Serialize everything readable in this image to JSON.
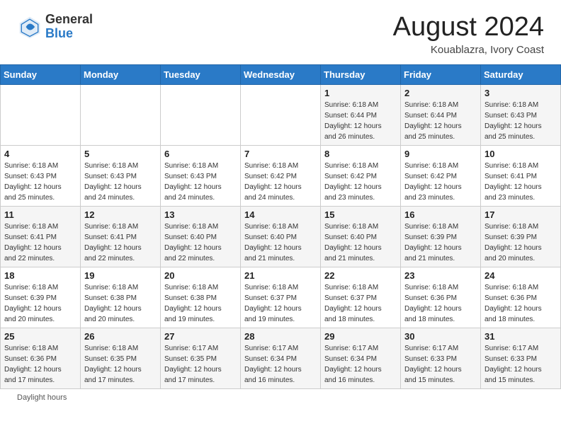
{
  "logo": {
    "general": "General",
    "blue": "Blue"
  },
  "title": {
    "main": "August 2024",
    "sub": "Kouablazra, Ivory Coast"
  },
  "calendar": {
    "headers": [
      "Sunday",
      "Monday",
      "Tuesday",
      "Wednesday",
      "Thursday",
      "Friday",
      "Saturday"
    ],
    "weeks": [
      [
        {
          "day": "",
          "info": ""
        },
        {
          "day": "",
          "info": ""
        },
        {
          "day": "",
          "info": ""
        },
        {
          "day": "",
          "info": ""
        },
        {
          "day": "1",
          "info": "Sunrise: 6:18 AM\nSunset: 6:44 PM\nDaylight: 12 hours\nand 26 minutes."
        },
        {
          "day": "2",
          "info": "Sunrise: 6:18 AM\nSunset: 6:44 PM\nDaylight: 12 hours\nand 25 minutes."
        },
        {
          "day": "3",
          "info": "Sunrise: 6:18 AM\nSunset: 6:43 PM\nDaylight: 12 hours\nand 25 minutes."
        }
      ],
      [
        {
          "day": "4",
          "info": "Sunrise: 6:18 AM\nSunset: 6:43 PM\nDaylight: 12 hours\nand 25 minutes."
        },
        {
          "day": "5",
          "info": "Sunrise: 6:18 AM\nSunset: 6:43 PM\nDaylight: 12 hours\nand 24 minutes."
        },
        {
          "day": "6",
          "info": "Sunrise: 6:18 AM\nSunset: 6:43 PM\nDaylight: 12 hours\nand 24 minutes."
        },
        {
          "day": "7",
          "info": "Sunrise: 6:18 AM\nSunset: 6:42 PM\nDaylight: 12 hours\nand 24 minutes."
        },
        {
          "day": "8",
          "info": "Sunrise: 6:18 AM\nSunset: 6:42 PM\nDaylight: 12 hours\nand 23 minutes."
        },
        {
          "day": "9",
          "info": "Sunrise: 6:18 AM\nSunset: 6:42 PM\nDaylight: 12 hours\nand 23 minutes."
        },
        {
          "day": "10",
          "info": "Sunrise: 6:18 AM\nSunset: 6:41 PM\nDaylight: 12 hours\nand 23 minutes."
        }
      ],
      [
        {
          "day": "11",
          "info": "Sunrise: 6:18 AM\nSunset: 6:41 PM\nDaylight: 12 hours\nand 22 minutes."
        },
        {
          "day": "12",
          "info": "Sunrise: 6:18 AM\nSunset: 6:41 PM\nDaylight: 12 hours\nand 22 minutes."
        },
        {
          "day": "13",
          "info": "Sunrise: 6:18 AM\nSunset: 6:40 PM\nDaylight: 12 hours\nand 22 minutes."
        },
        {
          "day": "14",
          "info": "Sunrise: 6:18 AM\nSunset: 6:40 PM\nDaylight: 12 hours\nand 21 minutes."
        },
        {
          "day": "15",
          "info": "Sunrise: 6:18 AM\nSunset: 6:40 PM\nDaylight: 12 hours\nand 21 minutes."
        },
        {
          "day": "16",
          "info": "Sunrise: 6:18 AM\nSunset: 6:39 PM\nDaylight: 12 hours\nand 21 minutes."
        },
        {
          "day": "17",
          "info": "Sunrise: 6:18 AM\nSunset: 6:39 PM\nDaylight: 12 hours\nand 20 minutes."
        }
      ],
      [
        {
          "day": "18",
          "info": "Sunrise: 6:18 AM\nSunset: 6:39 PM\nDaylight: 12 hours\nand 20 minutes."
        },
        {
          "day": "19",
          "info": "Sunrise: 6:18 AM\nSunset: 6:38 PM\nDaylight: 12 hours\nand 20 minutes."
        },
        {
          "day": "20",
          "info": "Sunrise: 6:18 AM\nSunset: 6:38 PM\nDaylight: 12 hours\nand 19 minutes."
        },
        {
          "day": "21",
          "info": "Sunrise: 6:18 AM\nSunset: 6:37 PM\nDaylight: 12 hours\nand 19 minutes."
        },
        {
          "day": "22",
          "info": "Sunrise: 6:18 AM\nSunset: 6:37 PM\nDaylight: 12 hours\nand 18 minutes."
        },
        {
          "day": "23",
          "info": "Sunrise: 6:18 AM\nSunset: 6:36 PM\nDaylight: 12 hours\nand 18 minutes."
        },
        {
          "day": "24",
          "info": "Sunrise: 6:18 AM\nSunset: 6:36 PM\nDaylight: 12 hours\nand 18 minutes."
        }
      ],
      [
        {
          "day": "25",
          "info": "Sunrise: 6:18 AM\nSunset: 6:36 PM\nDaylight: 12 hours\nand 17 minutes."
        },
        {
          "day": "26",
          "info": "Sunrise: 6:18 AM\nSunset: 6:35 PM\nDaylight: 12 hours\nand 17 minutes."
        },
        {
          "day": "27",
          "info": "Sunrise: 6:17 AM\nSunset: 6:35 PM\nDaylight: 12 hours\nand 17 minutes."
        },
        {
          "day": "28",
          "info": "Sunrise: 6:17 AM\nSunset: 6:34 PM\nDaylight: 12 hours\nand 16 minutes."
        },
        {
          "day": "29",
          "info": "Sunrise: 6:17 AM\nSunset: 6:34 PM\nDaylight: 12 hours\nand 16 minutes."
        },
        {
          "day": "30",
          "info": "Sunrise: 6:17 AM\nSunset: 6:33 PM\nDaylight: 12 hours\nand 15 minutes."
        },
        {
          "day": "31",
          "info": "Sunrise: 6:17 AM\nSunset: 6:33 PM\nDaylight: 12 hours\nand 15 minutes."
        }
      ]
    ]
  },
  "footer": {
    "note": "Daylight hours"
  }
}
